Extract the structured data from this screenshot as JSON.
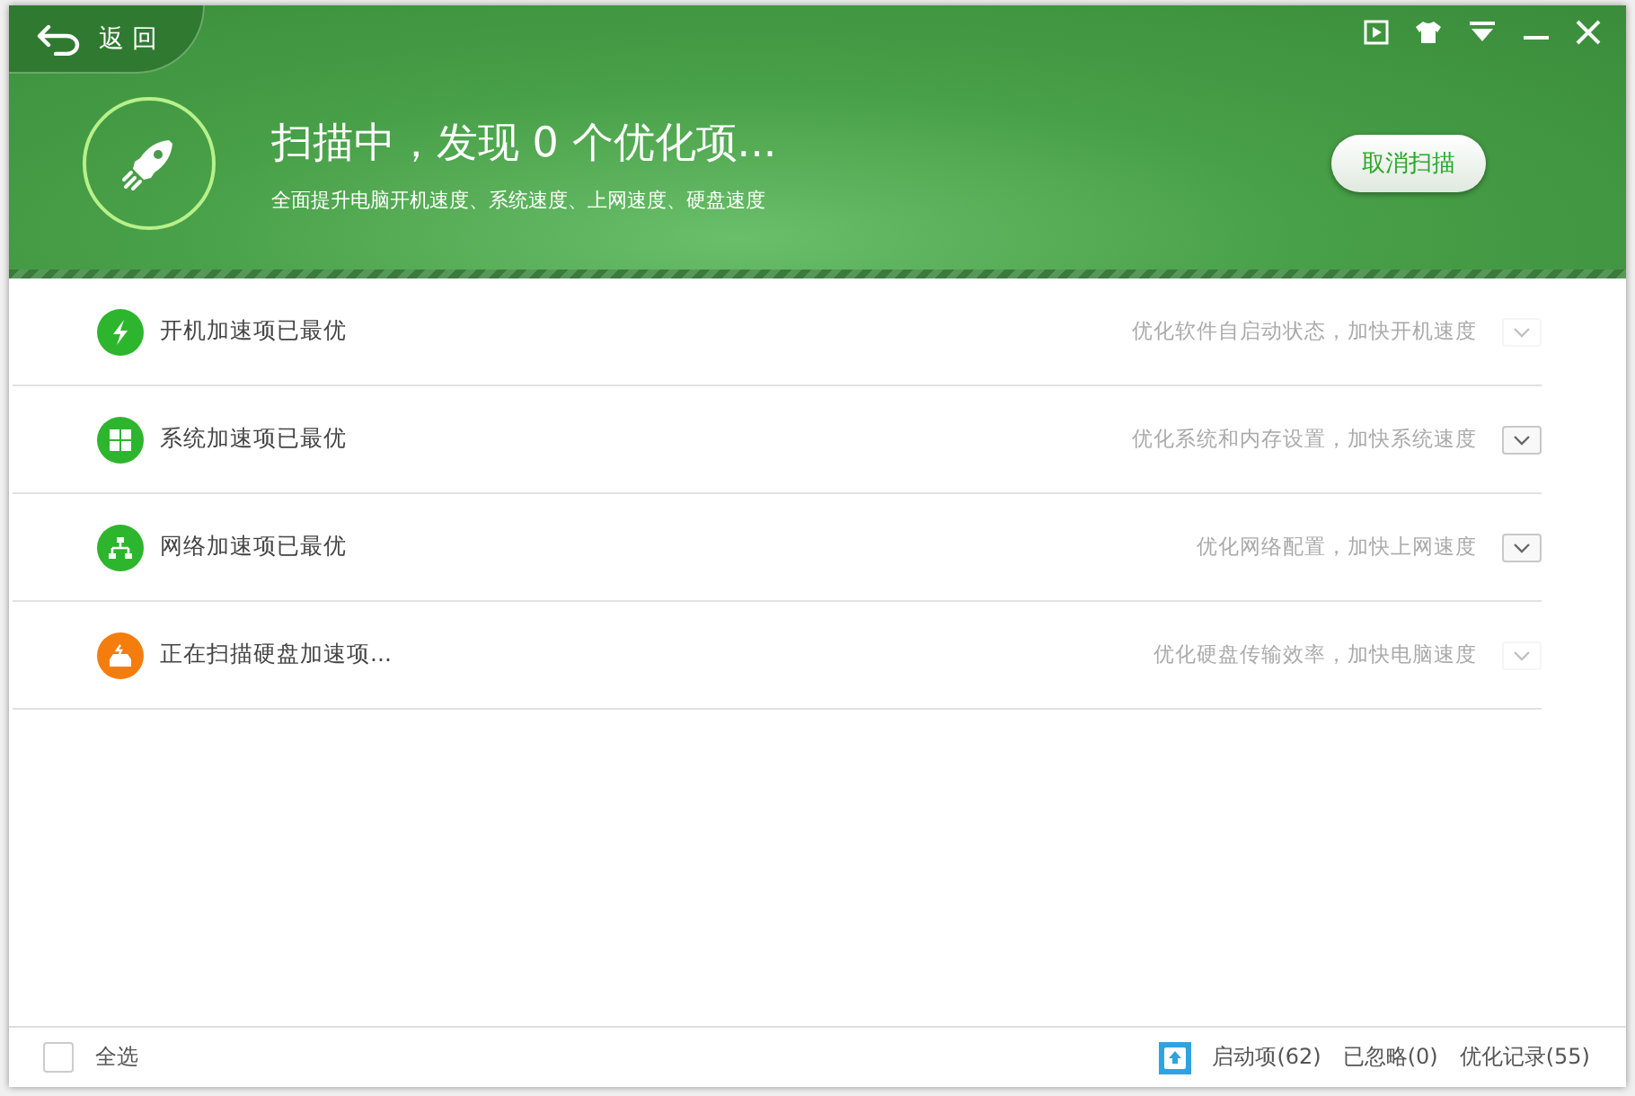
{
  "back": {
    "label": "返 回"
  },
  "header": {
    "title": "扫描中，发现 0 个优化项...",
    "subtitle": "全面提升电脑开机速度、系统速度、上网速度、硬盘速度",
    "cancel_button": "取消扫描"
  },
  "items": [
    {
      "kind": "startup",
      "scanning": false,
      "label": "开机加速项已最优",
      "description": "优化软件自启动状态，加快开机速度",
      "expand_disabled": true
    },
    {
      "kind": "system",
      "scanning": false,
      "label": "系统加速项已最优",
      "description": "优化系统和内存设置，加快系统速度",
      "expand_disabled": false
    },
    {
      "kind": "network",
      "scanning": false,
      "label": "网络加速项已最优",
      "description": "优化网络配置，加快上网速度",
      "expand_disabled": false
    },
    {
      "kind": "disk",
      "scanning": true,
      "label": "正在扫描硬盘加速项...",
      "description": "优化硬盘传输效率，加快电脑速度",
      "expand_disabled": true
    }
  ],
  "footer": {
    "select_all": {
      "label": "全选",
      "checked": false
    },
    "links": [
      "启动项(62)",
      "已忽略(0)",
      "优化记录(55)"
    ]
  }
}
